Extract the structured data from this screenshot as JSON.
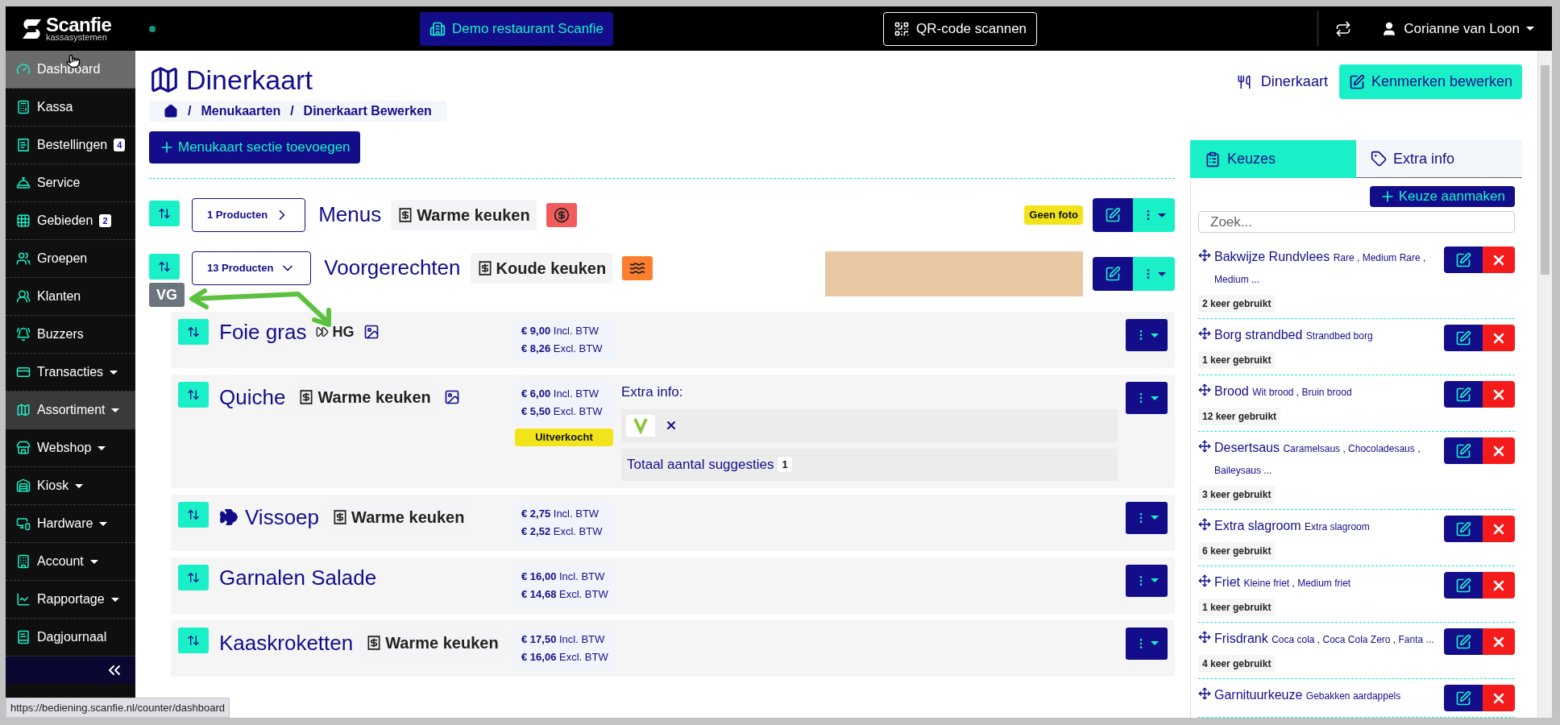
{
  "topbar": {
    "logo_name": "Scanfie",
    "logo_sub": "kassasystemen",
    "restaurant_button": "Demo restaurant Scanfie",
    "qr_button": "QR-code scannen",
    "user": "Corianne van Loon"
  },
  "sidebar": {
    "items": [
      {
        "label": "Dashboard",
        "hovered": true,
        "selected": false,
        "dropdown": false
      },
      {
        "label": "Kassa",
        "hovered": false,
        "selected": false,
        "dropdown": false
      },
      {
        "label": "Bestellingen",
        "badge": "4",
        "hovered": false,
        "selected": false,
        "dropdown": false
      },
      {
        "label": "Service",
        "hovered": false,
        "selected": false,
        "dropdown": false
      },
      {
        "label": "Gebieden",
        "badge": "2",
        "hovered": false,
        "selected": false,
        "dropdown": false
      },
      {
        "label": "Groepen",
        "hovered": false,
        "selected": false,
        "dropdown": false
      },
      {
        "label": "Klanten",
        "hovered": false,
        "selected": false,
        "dropdown": false
      },
      {
        "label": "Buzzers",
        "hovered": false,
        "selected": false,
        "dropdown": false
      },
      {
        "label": "Transacties",
        "hovered": false,
        "selected": false,
        "dropdown": true
      },
      {
        "label": "Assortiment",
        "hovered": false,
        "selected": true,
        "dropdown": true
      },
      {
        "label": "Webshop",
        "hovered": false,
        "selected": false,
        "dropdown": true
      },
      {
        "label": "Kiosk",
        "hovered": false,
        "selected": false,
        "dropdown": true
      },
      {
        "label": "Hardware",
        "hovered": false,
        "selected": false,
        "dropdown": true
      },
      {
        "label": "Account",
        "hovered": false,
        "selected": false,
        "dropdown": true
      },
      {
        "label": "Rapportage",
        "hovered": false,
        "selected": false,
        "dropdown": true
      },
      {
        "label": "Dagjournaal",
        "hovered": false,
        "selected": false,
        "dropdown": false
      }
    ]
  },
  "page": {
    "title": "Dinerkaart",
    "breadcrumb": [
      {
        "separator": "/",
        "label": "Menukaarten"
      },
      {
        "separator": "/",
        "label": "Dinerkaart Bewerken"
      }
    ],
    "menu_link": "Dinerkaart",
    "edit_button": "Kenmerken bewerken",
    "add_section_button": "Menukaart sectie toevoegen"
  },
  "sections": [
    {
      "products_button": "1 Producten",
      "expanded": false,
      "name": "Menus",
      "kitchen": "Warme keuken",
      "tag": {
        "kind": "price",
        "color": "#f25c5c"
      },
      "no_photo_label": "Geen foto"
    },
    {
      "products_button": "13 Producten",
      "expanded": true,
      "name": "Voorgerechten",
      "kitchen": "Koude keuken",
      "tag": {
        "kind": "swim",
        "color": "#fb7f2c"
      },
      "has_photo": true,
      "course": "VG",
      "products": [
        {
          "name": "Foie gras",
          "course": "HG",
          "has_image": true,
          "price_incl": "€ 9,00",
          "incl_label": "Incl. BTW",
          "price_excl": "€ 8,26",
          "excl_label": "Excl. BTW"
        },
        {
          "name": "Quiche",
          "kitchen": "Warme keuken",
          "has_image": true,
          "price_incl": "€ 6,00",
          "incl_label": "Incl. BTW",
          "price_excl": "€ 5,50",
          "excl_label": "Excl. BTW",
          "sold_out_label": "Uitverkocht",
          "extra_info": {
            "title": "Extra info:",
            "suggestions_label": "Totaal aantal suggesties",
            "suggestions_count": "1"
          }
        },
        {
          "name": "Vissoep",
          "has_icon": true,
          "kitchen": "Warme keuken",
          "price_incl": "€ 2,75",
          "incl_label": "Incl. BTW",
          "price_excl": "€ 2,52",
          "excl_label": "Excl. BTW"
        },
        {
          "name": "Garnalen Salade",
          "price_incl": "€ 16,00",
          "incl_label": "Incl. BTW",
          "price_excl": "€ 14,68",
          "excl_label": "Excl. BTW"
        },
        {
          "name": "Kaaskroketten",
          "kitchen": "Warme keuken",
          "price_incl": "€ 17,50",
          "incl_label": "Incl. BTW",
          "price_excl": "€ 16,06",
          "excl_label": "Excl. BTW"
        }
      ]
    }
  ],
  "choices_panel": {
    "tabs": [
      {
        "label": "Keuzes",
        "selected": true
      },
      {
        "label": "Extra info",
        "selected": false
      }
    ],
    "create_button": "Keuze aanmaken",
    "search": {
      "placeholder": "Zoek..."
    },
    "choices": [
      {
        "name": "Bakwijze Rundvlees",
        "options": "Rare , Medium Rare , Medium ...",
        "usage": "2 keer gebruikt"
      },
      {
        "name": "Borg strandbed",
        "options": "Strandbed borg",
        "usage": "1 keer gebruikt"
      },
      {
        "name": "Brood",
        "options": "Wit brood , Bruin brood",
        "usage": "12 keer gebruikt"
      },
      {
        "name": "Desertsaus",
        "options": "Caramelsaus , Chocoladesaus , Baileysaus ...",
        "usage": "3 keer gebruikt"
      },
      {
        "name": "Extra slagroom",
        "options": "Extra slagroom",
        "usage": "6 keer gebruikt"
      },
      {
        "name": "Friet",
        "options": "Kleine friet , Medium friet",
        "usage": "1 keer gebruikt"
      },
      {
        "name": "Frisdrank",
        "options": "Coca cola , Coca Cola Zero , Fanta ...",
        "usage": "4 keer gebruikt"
      },
      {
        "name": "Garnituurkeuze",
        "options": "Gebakken aardappels"
      }
    ]
  },
  "status_url": "https://bediening.scanfie.nl/counter/dashboard"
}
